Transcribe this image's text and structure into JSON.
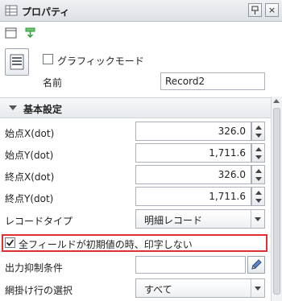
{
  "window": {
    "title": "プロパティ",
    "pin_label": "☐",
    "close_label": "×"
  },
  "toolbar": {
    "items": [
      "properties-view-icon",
      "apply-icon"
    ]
  },
  "header": {
    "graphic_mode_label": "グラフィックモード",
    "graphic_mode_checked": false,
    "name_label": "名前",
    "name_value": "Record2"
  },
  "section": {
    "title": "基本設定"
  },
  "fields": [
    {
      "label": "始点X(dot)",
      "value": "326.0"
    },
    {
      "label": "始点Y(dot)",
      "value": "1,711.6"
    },
    {
      "label": "終点X(dot)",
      "value": "326.0"
    },
    {
      "label": "終点Y(dot)",
      "value": "1,711.6"
    }
  ],
  "record_type": {
    "label": "レコードタイプ",
    "value": "明細レコード"
  },
  "no_print": {
    "label": "全フィールドが初期値の時、印字しない",
    "checked": true
  },
  "output_suppress": {
    "label": "出力抑制条件",
    "value": ""
  },
  "mesh_row": {
    "label": "網掛け行の選択",
    "value": "すべて"
  },
  "colors": {
    "highlight_border": "#e0302f",
    "accent_green": "#2e9b3a"
  }
}
